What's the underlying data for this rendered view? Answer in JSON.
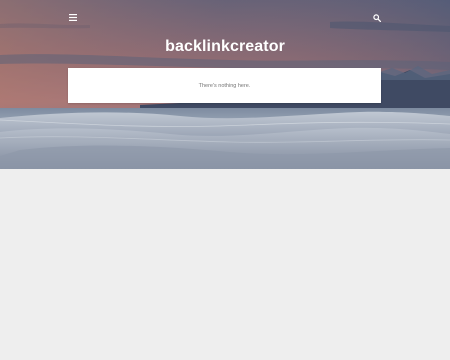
{
  "header": {
    "blog_title": "backlinkcreator",
    "menu_icon": "hamburger-menu-icon",
    "search_icon": "search-icon"
  },
  "main": {
    "empty_message": "There's nothing here."
  },
  "colors": {
    "title_text": "#ffffff",
    "card_background": "#ffffff",
    "page_background": "#eeeeee",
    "message_text": "#757575"
  }
}
